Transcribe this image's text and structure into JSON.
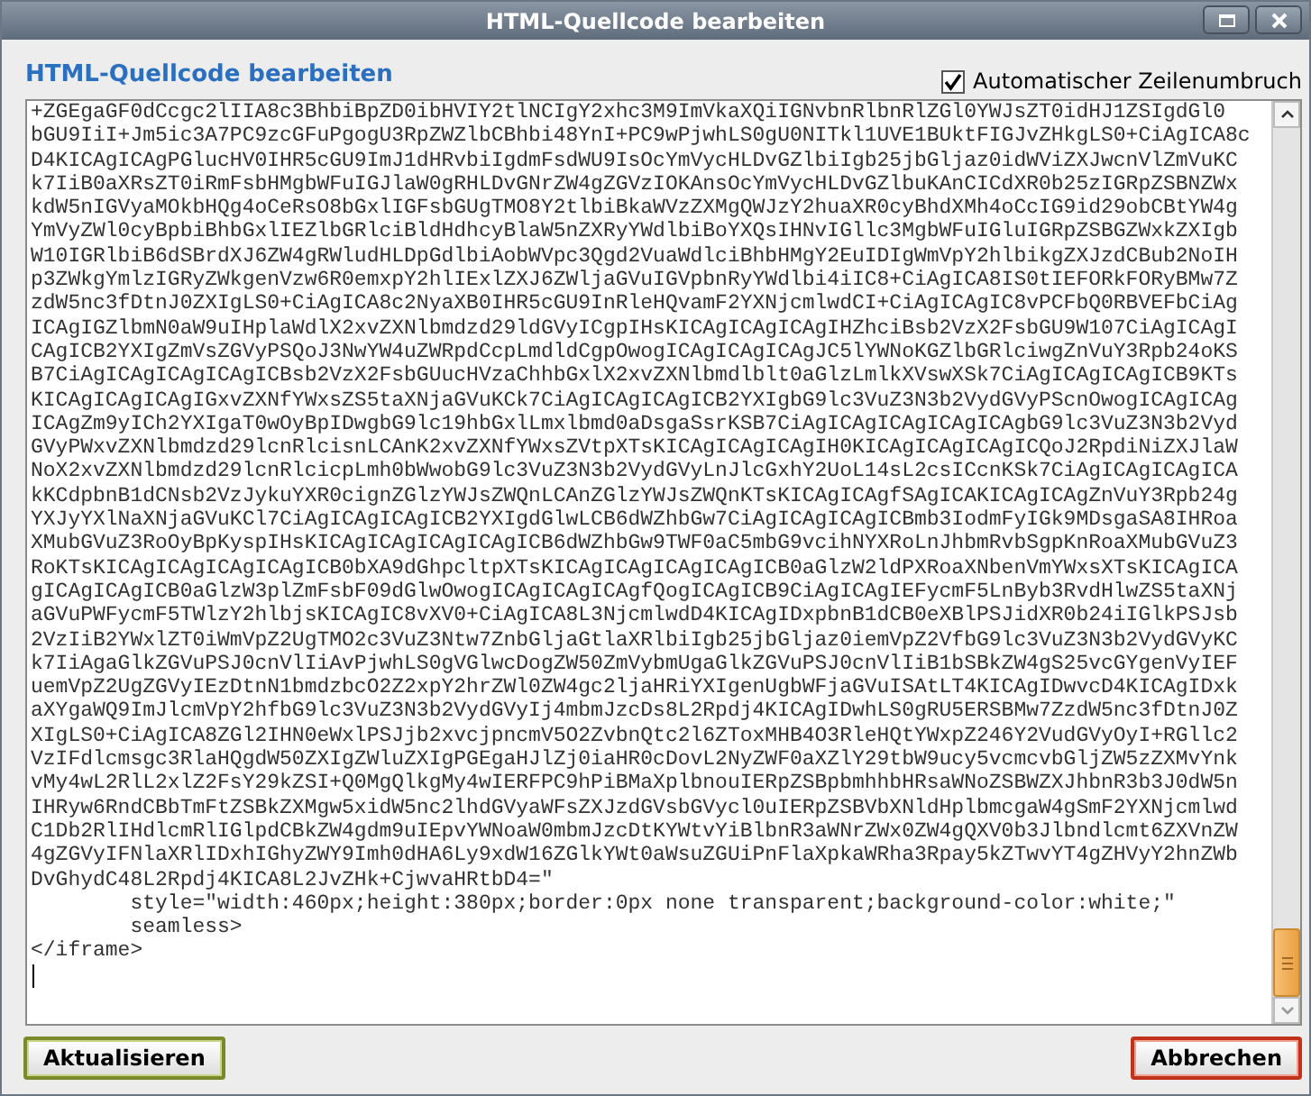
{
  "window": {
    "title": "HTML-Quellcode bearbeiten"
  },
  "heading": "HTML-Quellcode bearbeiten",
  "word_wrap": {
    "label": "Automatischer Zeilenumbruch",
    "checked": true
  },
  "editor": {
    "lines": [
      "+ZGEgaGF0dCcgc2lIIA8c3BhbiBpZD0ibHVIY2tlNCIgY2xhc3M9ImVkaXQiIGNvbnRlbnRlZGl0YWJsZT0idHJ1ZSIgdGl0",
      "bGU9IiI+Jm5ic3A7PC9zcGFuPgogU3RpZWZlbCBhbi48YnI+PC9wPjwhLS0gU0NITkl1UVE1BUktFIGJvZHkgLS0+CiAgICA8c",
      "D4KICAgICAgPGlucHV0IHR5cGU9ImJ1dHRvbiIgdmFsdWU9IsOcYmVycHLDvGZlbiIgb25jbGljaz0idWViZXJwcnVlZmVuKC",
      "k7IiB0aXRsZT0iRmFsbHMgbWFuIGJlaW0gRHLDvGNrZW4gZGVzIOKAnsOcYmVycHLDvGZlbuKAnCICdXR0b25zIGRpZSBNZWx",
      "kdW5nIGVyaMOkbHQg4oCeRsO8bGxlIGFsbGUgTMO8Y2tlbiBkaWVzZXMgQWJzY2huaXR0cyBhdXMh4oCcIG9id29obCBtYW4g",
      "YmVyZWl0cyBpbiBhbGxlIEZlbGRlciBldHdhcyBlaW5nZXRyYWdlbiBoYXQsIHNvIGllc3MgbWFuIGluIGRpZSBGZWxkZXIgb",
      "W10IGRlbiB6dSBrdXJ6ZW4gRWludHLDpGdlbiAobWVpc3Qgd2VuaWdlciBhbHMgY2EuIDIgWmVpY2hlbikgZXJzdCBub2NoIH",
      "p3ZWkgYmlzIGRyZWkgenVzw6R0emxpY2hlIExlZXJ6ZWljaGVuIGVpbnRyYWdlbi4iIC8+CiAgICA8IS0tIEFORkFORyBMw7Z",
      "zdW5nc3fDtnJ0ZXIgLS0+CiAgICA8c2NyaXB0IHR5cGU9InRleHQvamF2YXNjcmlwdCI+CiAgICAgIC8vPCFbQ0RBVEFbCiAg",
      "ICAgIGZlbmN0aW9uIHplaWdlX2xvZXNlbmdzd29ldGVyICgpIHsKICAgICAgICAgIHZhciBsb2VzX2FsbGU9W107CiAgICAgI",
      "CAgICB2YXIgZmVsZGVyPSQoJ3NwYW4uZWRpdCcpLmdldCgpOwogICAgICAgICAgJC5lYWNoKGZlbGRlciwgZnVuY3Rpb24oKS",
      "B7CiAgICAgICAgICAgICBsb2VzX2FsbGUucHVzaChhbGxlX2xvZXNlbmdlblt0aGlzLmlkXVswXSk7CiAgICAgICAgICB9KTs",
      "KICAgICAgICAgIGxvZXNfYWxsZS5taXNjaGVuKCk7CiAgICAgICAgICB2YXIgbG9lc3VuZ3N3b2VydGVyPScnOwogICAgICAg",
      "ICAgZm9yICh2YXIgaT0wOyBpIDwgbG9lc19hbGxlLmxlbmd0aDsgaSsrKSB7CiAgICAgICAgICAgICAgbG9lc3VuZ3N3b2Vyd",
      "GVyPWxvZXNlbmdzd29lcnRlcisnLCAnK2xvZXNfYWxsZVtpXTsKICAgICAgICAgIH0KICAgICAgICAgICQoJ2RpdiNiZXJlaW",
      "NoX2xvZXNlbmdzd29lcnRlcicpLmh0bWwobG9lc3VuZ3N3b2VydGVyLnJlcGxhY2UoL14sL2csICcnKSk7CiAgICAgICAgICA",
      "kKCdpbnB1dCNsb2VzJykuYXR0cignZGlzYWJsZWQnLCAnZGlzYWJsZWQnKTsKICAgICAgfSAgICAKICAgICAgZnVuY3Rpb24g",
      "YXJyYXlNaXNjaGVuKCl7CiAgICAgICAgICB2YXIgdGlwLCB6dWZhbGw7CiAgICAgICAgICBmb3IodmFyIGk9MDsgaSA8IHRoa",
      "XMubGVuZ3RoOyBpKyspIHsKICAgICAgICAgICAgICB6dWZhbGw9TWF0aC5mbG9vcihNYXRoLnJhbmRvbSgpKnRoaXMubGVuZ3",
      "RoKTsKICAgICAgICAgICAgICB0bXA9dGhpcltpXTsKICAgICAgICAgICAgICB0aGlzW2ldPXRoaXNbenVmYWxsXTsKICAgICA",
      "gICAgICAgICB0aGlzW3plZmFsbF09dGlwOwogICAgICAgICAgfQogICAgICB9CiAgICAgIEFycmF5LnByb3RvdHlwZS5taXNj",
      "aGVuPWFycmF5TWlzY2hlbjsKICAgIC8vXV0+CiAgICA8L3NjcmlwdD4KICAgIDxpbnB1dCB0eXBlPSJidXR0b24iIGlkPSJsb",
      "2VzIiB2YWxlZT0iWmVpZ2UgTMO2c3VuZ3Ntw7ZnbGljaGtlaXRlbiIgb25jbGljaz0iemVpZ2VfbG9lc3VuZ3N3b2VydGVyKC",
      "k7IiAgaGlkZGVuPSJ0cnVlIiAvPjwhLS0gVGlwcDogZW50ZmVybmUgaGlkZGVuPSJ0cnVlIiB1bSBkZW4gS25vcGYgenVyIEF",
      "uemVpZ2UgZGVyIEzDtnN1bmdzbcO2Z2xpY2hrZWl0ZW4gc2ljaHRiYXIgenUgbWFjaGVuISAtLT4KICAgIDwvcD4KICAgIDxk",
      "aXYgaWQ9ImJlcmVpY2hfbG9lc3VuZ3N3b2VydGVyIj4mbmJzcDs8L2Rpdj4KICAgIDwhLS0gRU5ERSBMw7ZzdW5nc3fDtnJ0Z",
      "XIgLS0+CiAgICA8ZGl2IHN0eWxlPSJjb2xvcjpncmV5O2ZvbnQtc2l6ZToxMHB4O3RleHQtYWxpZ246Y2VudGVyOyI+RGllc2",
      "VzIFdlcmsgc3RlaHQgdW50ZXIgZWluZXIgPGEgaHJlZj0iaHR0cDovL2NyZWF0aXZlY29tbW9ucy5vcmcvbGljZW5zZXMvYnk",
      "vMy4wL2RlL2xlZ2FsY29kZSI+Q0MgQlkgMy4wIERFPC9hPiBMaXplbnouIERpZSBpbmhhbHRsaWNoZSBWZXJhbnR3b3J0dW5n",
      "IHRyw6RndCBbTmFtZSBkZXMgw5xidW5nc2lhdGVyaWFsZXJzdGVsbGVycl0uIERpZSBVbXNldHplbmcgaW4gSmF2YXNjcmlwd",
      "C1Db2RlIHdlcmRlIGlpdCBkZW4gdm9uIEpvYWNoaW0mbmJzcDtKYWtvYiBlbnR3aWNrZWx0ZW4gQXV0b3Jlbndlcmt6ZXVnZW",
      "4gZGVyIFNlaXRlIDxhIGhyZWY9Imh0dHA6Ly9xdW16ZGlkYWt0aWsuZGUiPnFlaXpkaWRha3Rpay5kZTwvYT4gZHVyY2hnZWb",
      "DvGhydC48L2Rpdj4KICA8L2JvZHk+CjwvaHRtbD4=\"",
      "        style=\"width:460px;height:380px;border:0px none transparent;background-color:white;\"",
      "        seamless>",
      "</iframe>"
    ]
  },
  "buttons": [
    {
      "label": "Aktualisieren",
      "kind": "confirm"
    },
    {
      "label": "Abbrechen",
      "kind": "cancel"
    }
  ]
}
